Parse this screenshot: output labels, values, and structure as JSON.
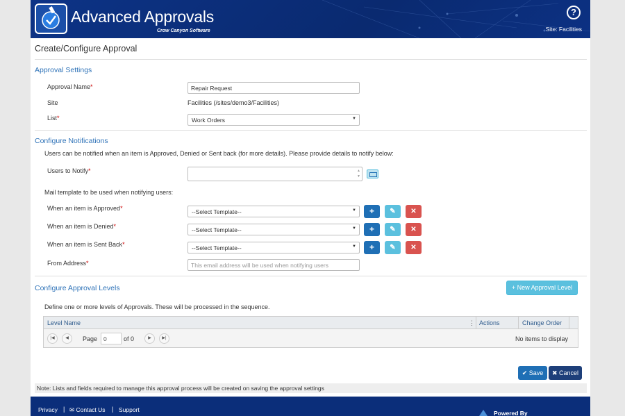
{
  "header": {
    "app_title": "Advanced Approvals",
    "app_subtitle": "Crow Canyon Software",
    "help_glyph": "?",
    "site_label": "Site: Facilities"
  },
  "page": {
    "title": "Create/Configure Approval"
  },
  "approval_settings": {
    "section_title": "Approval Settings",
    "approval_name_label": "Approval Name",
    "approval_name_value": "Repair Request",
    "site_label": "Site",
    "site_value": "Facilities (/sites/demo3/Facilities)",
    "list_label": "List",
    "list_value": "Work Orders",
    "required_mark": "*"
  },
  "notifications": {
    "section_title": "Configure Notifications",
    "intro": "Users can be notified when an item is Approved, Denied or Sent back (for more details). Please provide details to notify below:",
    "users_label": "Users to Notify",
    "mail_template_label": "Mail template to be used when notifying users:",
    "approved_label": "When an item is Approved",
    "denied_label": "When an item is Denied",
    "sent_back_label": "When an item is Sent Back",
    "template_placeholder": "--Select Template--",
    "from_label": "From Address",
    "from_placeholder": "This email address will be used when notifying users",
    "add_glyph": "+",
    "edit_glyph": "✎",
    "delete_glyph": "✕"
  },
  "approval_levels": {
    "section_title": "Configure Approval Levels",
    "new_level_button": "+ New Approval Level",
    "intro": "Define one or more levels of Approvals. These will be processed in the sequence.",
    "columns": [
      "Level Name",
      "Actions",
      "Change Order"
    ],
    "col_menu_glyph": "⋮",
    "page_label": "Page",
    "page_value": "0",
    "of_label": "of 0",
    "empty_text": "No items to display"
  },
  "actions": {
    "save_label": "✔ Save",
    "cancel_label": "✖ Cancel"
  },
  "note": "Note: Lists and fields required to manage this approval process will be created on saving the approval settings",
  "footer": {
    "privacy": "Privacy",
    "contact": "✉ Contact Us",
    "support": "Support",
    "separator": "|",
    "powered_by": "Powered By"
  },
  "colors": {
    "header_bg": "#0b2e7a",
    "accent": "#2f73b8",
    "add_button": "#1f6fb5",
    "edit_button": "#5bc0de",
    "delete_button": "#d9534f"
  }
}
